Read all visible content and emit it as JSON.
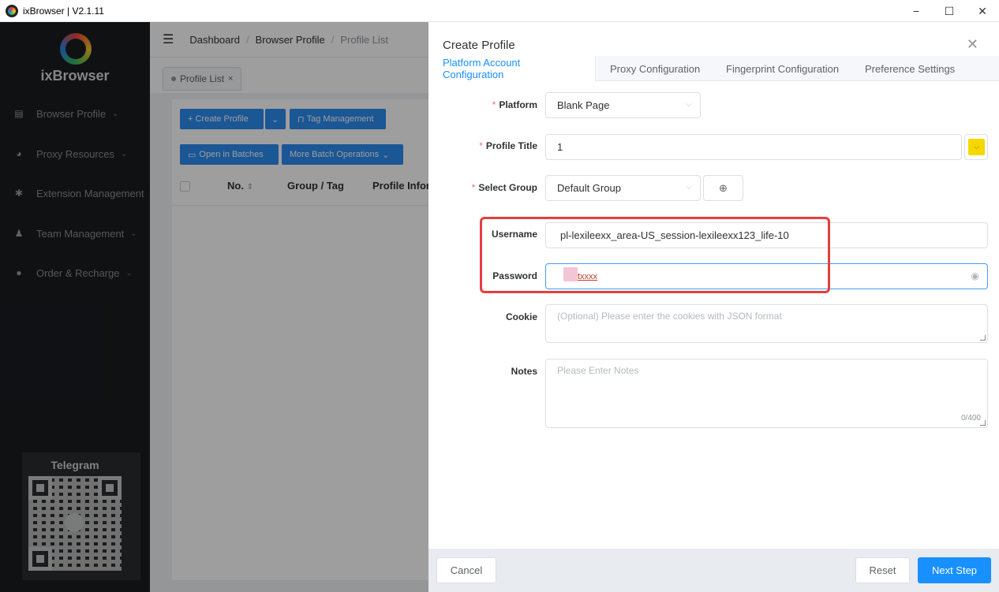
{
  "window": {
    "title": "ixBrowser | V2.1.11",
    "minimize": "−",
    "maximize": "☐",
    "close": "✕"
  },
  "sidebar": {
    "logo_text": "ixBrowser",
    "items": [
      {
        "label": "Browser Profile",
        "icon": "calendar-icon"
      },
      {
        "label": "Proxy Resources",
        "icon": "globe-icon"
      },
      {
        "label": "Extension Management",
        "icon": "puzzle-icon"
      },
      {
        "label": "Team Management",
        "icon": "user-icon"
      },
      {
        "label": "Order & Recharge",
        "icon": "info-icon"
      }
    ],
    "telegram_label": "Telegram"
  },
  "header": {
    "breadcrumb": [
      "Dashboard",
      "Browser Profile",
      "Profile List"
    ],
    "separator": "/"
  },
  "page_tab": {
    "label": "Profile List",
    "close": "×"
  },
  "toolbar": {
    "create_profile": "+ Create Profile",
    "tag_management": "Tag Management",
    "open_in_batches": "Open in Batches",
    "more_batch_operations": "More Batch Operations"
  },
  "table": {
    "columns": [
      "No.",
      "Group / Tag",
      "Profile Infor"
    ]
  },
  "drawer": {
    "title": "Create Profile",
    "close": "✕",
    "tabs": [
      "Platform Account Configuration",
      "Proxy Configuration",
      "Fingerprint Configuration",
      "Preference Settings"
    ],
    "required_mark": "*",
    "fields": {
      "platform": {
        "label": "Platform",
        "value": "Blank Page"
      },
      "profile_title": {
        "label": "Profile Title",
        "value": "1"
      },
      "select_group": {
        "label": "Select Group",
        "value": "Default Group"
      },
      "username": {
        "label": "Username",
        "value": "pl-lexileexx_area-US_session-lexileexx123_life-10"
      },
      "password": {
        "label": "Password",
        "value": "txxxx"
      },
      "cookie": {
        "label": "Cookie",
        "placeholder": "(Optional) Please enter the cookies with JSON format"
      },
      "notes": {
        "label": "Notes",
        "placeholder": "Please Enter Notes",
        "counter": "0/400"
      }
    },
    "footer": {
      "cancel": "Cancel",
      "reset": "Reset",
      "next": "Next Step"
    }
  },
  "colors": {
    "accent": "#1890ff",
    "highlight": "#e53e3e",
    "color_swatch": "#f5d800"
  }
}
